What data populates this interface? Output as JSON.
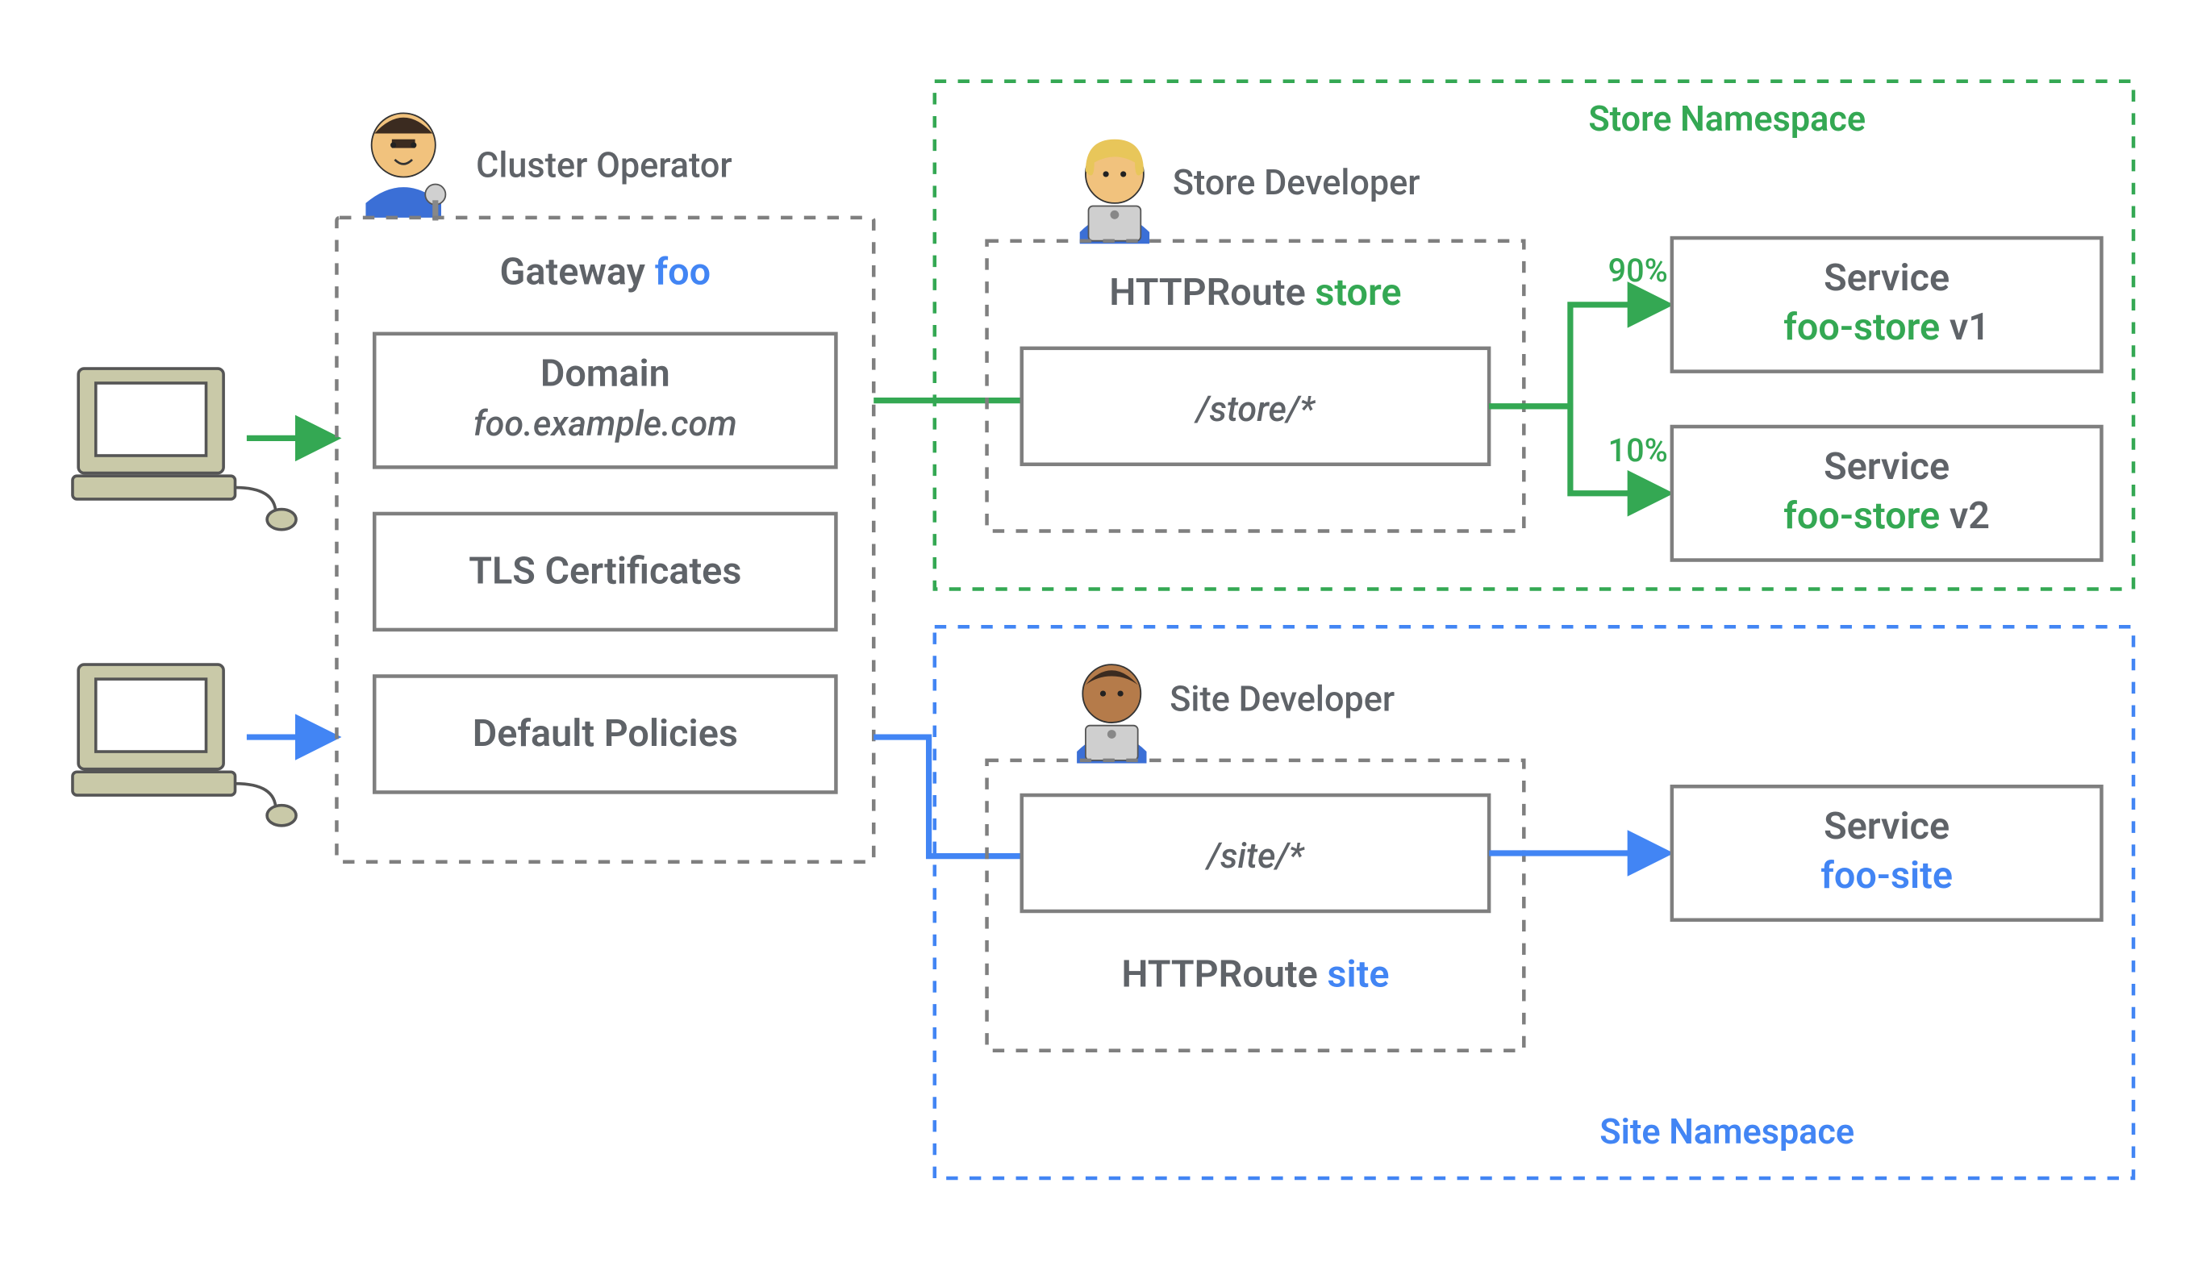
{
  "roles": {
    "cluster_operator": "Cluster Operator",
    "store_developer": "Store Developer",
    "site_developer": "Site Developer"
  },
  "gateway": {
    "title_prefix": "Gateway ",
    "title_name": "foo",
    "domain_label": "Domain",
    "domain_value": "foo.example.com",
    "tls_label": "TLS Certificates",
    "policies_label": "Default Policies"
  },
  "store": {
    "namespace_label": "Store Namespace",
    "route_prefix": "HTTPRoute ",
    "route_name": "store",
    "match": "/store/*",
    "svc_label": "Service",
    "svc1_name": "foo-store",
    "svc1_ver": " v1",
    "svc2_name": "foo-store",
    "svc2_ver": " v2",
    "w1": "90%",
    "w2": "10%"
  },
  "site": {
    "namespace_label": "Site Namespace",
    "route_prefix": "HTTPRoute ",
    "route_name": "site",
    "match": "/site/*",
    "svc_label": "Service",
    "svc_name": "foo-site"
  }
}
